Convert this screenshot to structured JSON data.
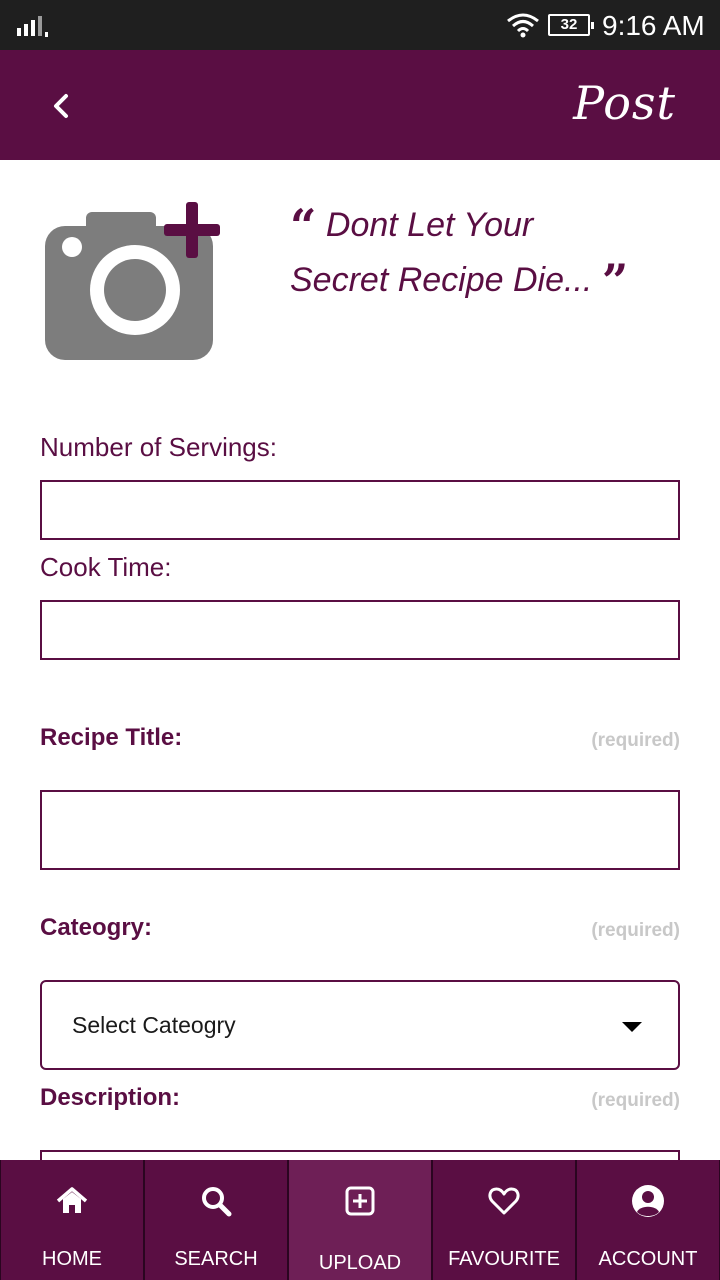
{
  "status_bar": {
    "battery": "32",
    "time": "9:16 AM"
  },
  "app_bar": {
    "post_label": "Post"
  },
  "quote": {
    "open_mark": "“",
    "line1": "Dont Let Your",
    "line2": "Secret Recipe Die...",
    "close_mark": "”"
  },
  "form": {
    "servings_label": "Number of Servings:",
    "cook_time_label": "Cook Time:",
    "title_label": "Recipe Title:",
    "title_required": "(required)",
    "category_label": "Cateogry:",
    "category_required": "(required)",
    "category_selected": "Select Cateogry",
    "description_label": "Description:",
    "description_required": "(required)"
  },
  "bottom_nav": [
    {
      "label": "HOME",
      "icon": "home-icon"
    },
    {
      "label": "SEARCH",
      "icon": "search-icon"
    },
    {
      "label": "UPLOAD",
      "icon": "add-square-icon",
      "active": true
    },
    {
      "label": "FAVOURITE",
      "icon": "heart-icon"
    },
    {
      "label": "ACCOUNT",
      "icon": "account-icon"
    }
  ],
  "colors": {
    "primary": "#5a0e43",
    "active_tab": "#6e1f56",
    "required": "#c8c8c8",
    "status_bar": "#1f1f1f"
  }
}
